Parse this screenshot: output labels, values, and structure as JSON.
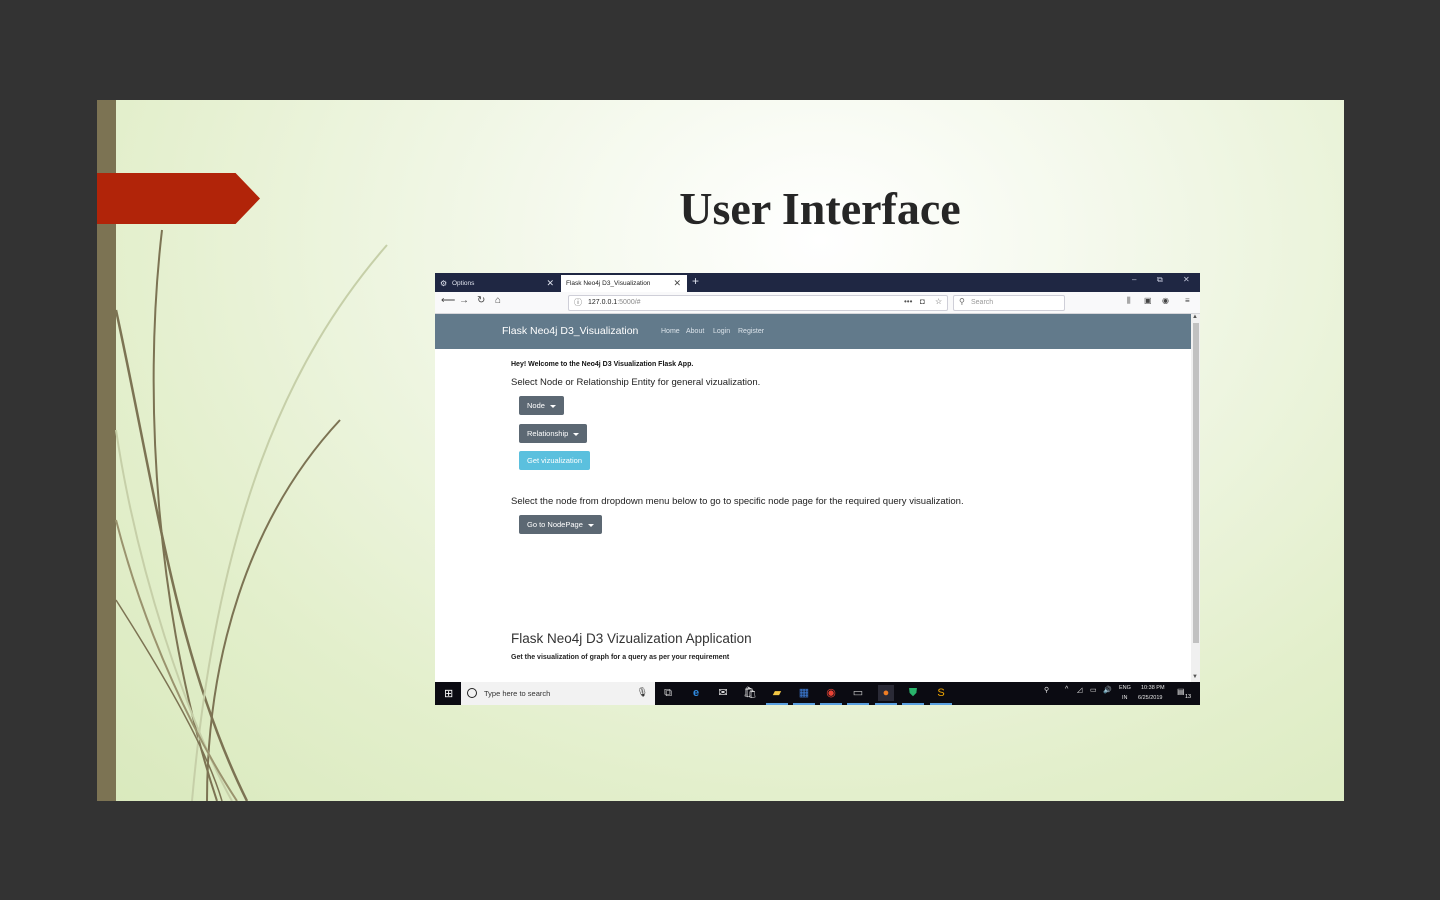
{
  "slide": {
    "title": "User Interface"
  },
  "browser": {
    "tabs": [
      {
        "label": "Options",
        "active": false
      },
      {
        "label": "Flask Neo4j D3_Visualization",
        "active": true
      }
    ],
    "url_host": "127.0.0.1",
    "url_path": ":5000/#",
    "search_placeholder": "Search",
    "window_controls": {
      "minimize": "–",
      "restore": "⧉",
      "close": "✕"
    }
  },
  "app": {
    "brand": "Flask Neo4j D3_Visualization",
    "nav_links": [
      "Home",
      "About",
      "Login",
      "Register"
    ],
    "welcome": "Hey! Welcome to the Neo4j D3 Visualization Flask App.",
    "select_text": "Select Node or Relationship Entity for general vizualization.",
    "node_button": "Node",
    "relationship_button": "Relationship",
    "get_viz_button": "Get vizualization",
    "node_page_text": "Select the node from dropdown menu below to go to specific node page for the required query visualization.",
    "nodepage_button": "Go to NodePage",
    "footer_heading": "Flask Neo4j D3 Vizualization Application",
    "footer_sub": "Get the visualization of graph for a query as per your requirement"
  },
  "taskbar": {
    "search_placeholder": "Type here to search",
    "lang_top": "ENG",
    "lang_bottom": "IN",
    "time": "10:38 PM",
    "date": "6/25/2019",
    "notification_count": "13"
  },
  "colors": {
    "slide_accent": "#b12409",
    "side_bar": "#7c7353",
    "app_nav": "#627a8b",
    "btn_dark": "#5c6873",
    "btn_info": "#5bc0de"
  }
}
